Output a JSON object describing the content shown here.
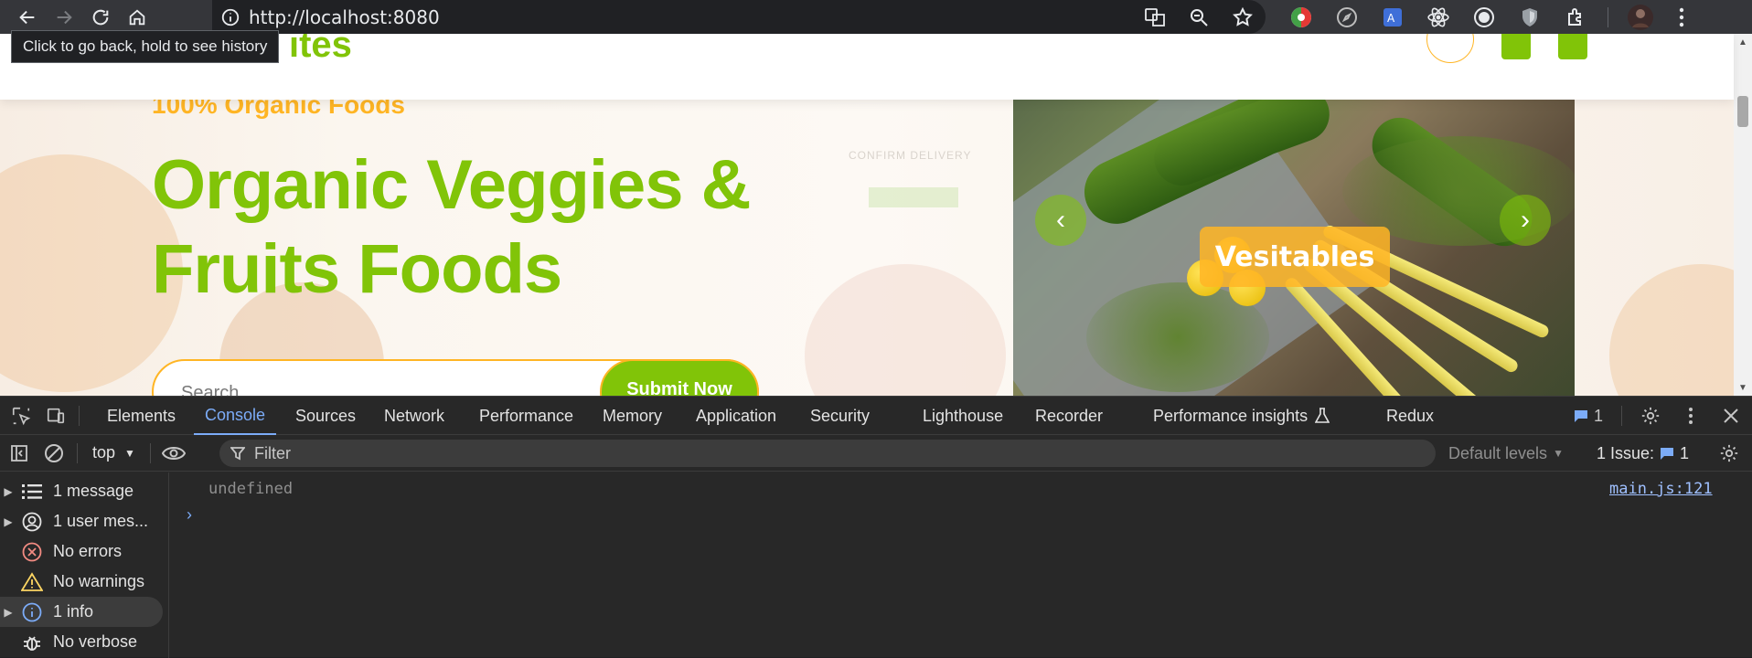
{
  "browser": {
    "url": "http://localhost:8080",
    "tooltip": "Click to go back, hold to see history"
  },
  "page": {
    "eyebrow": "100% Organic Foods",
    "headline_line1": "Organic Veggies &",
    "headline_line2": "Fruits Foods",
    "search_placeholder": "Search",
    "submit_label": "Submit Now",
    "ghost_text": "CONFIRM DELIVERY",
    "carousel_label": "Vesitables",
    "logo_fragment": "ites",
    "colors": {
      "primary": "#81c408",
      "secondary": "#ffb524"
    }
  },
  "devtools": {
    "tabs": [
      "Elements",
      "Console",
      "Sources",
      "Network",
      "Performance",
      "Memory",
      "Application",
      "Security",
      "Lighthouse",
      "Recorder",
      "Performance insights",
      "Redux"
    ],
    "active_tab": "Console",
    "message_badge_count": "1",
    "context": "top",
    "filter_placeholder": "Filter",
    "levels": "Default levels",
    "issues_label": "1 Issue:",
    "issues_count": "1",
    "sidebar": [
      {
        "label": "1 message",
        "icon": "list-icon"
      },
      {
        "label": "1 user mes...",
        "icon": "user-icon"
      },
      {
        "label": "No errors",
        "icon": "error-icon"
      },
      {
        "label": "No warnings",
        "icon": "warning-icon"
      },
      {
        "label": "1 info",
        "icon": "info-icon"
      },
      {
        "label": "No verbose",
        "icon": "bug-icon"
      }
    ],
    "log": {
      "text": "undefined",
      "source": "main.js:121"
    }
  }
}
